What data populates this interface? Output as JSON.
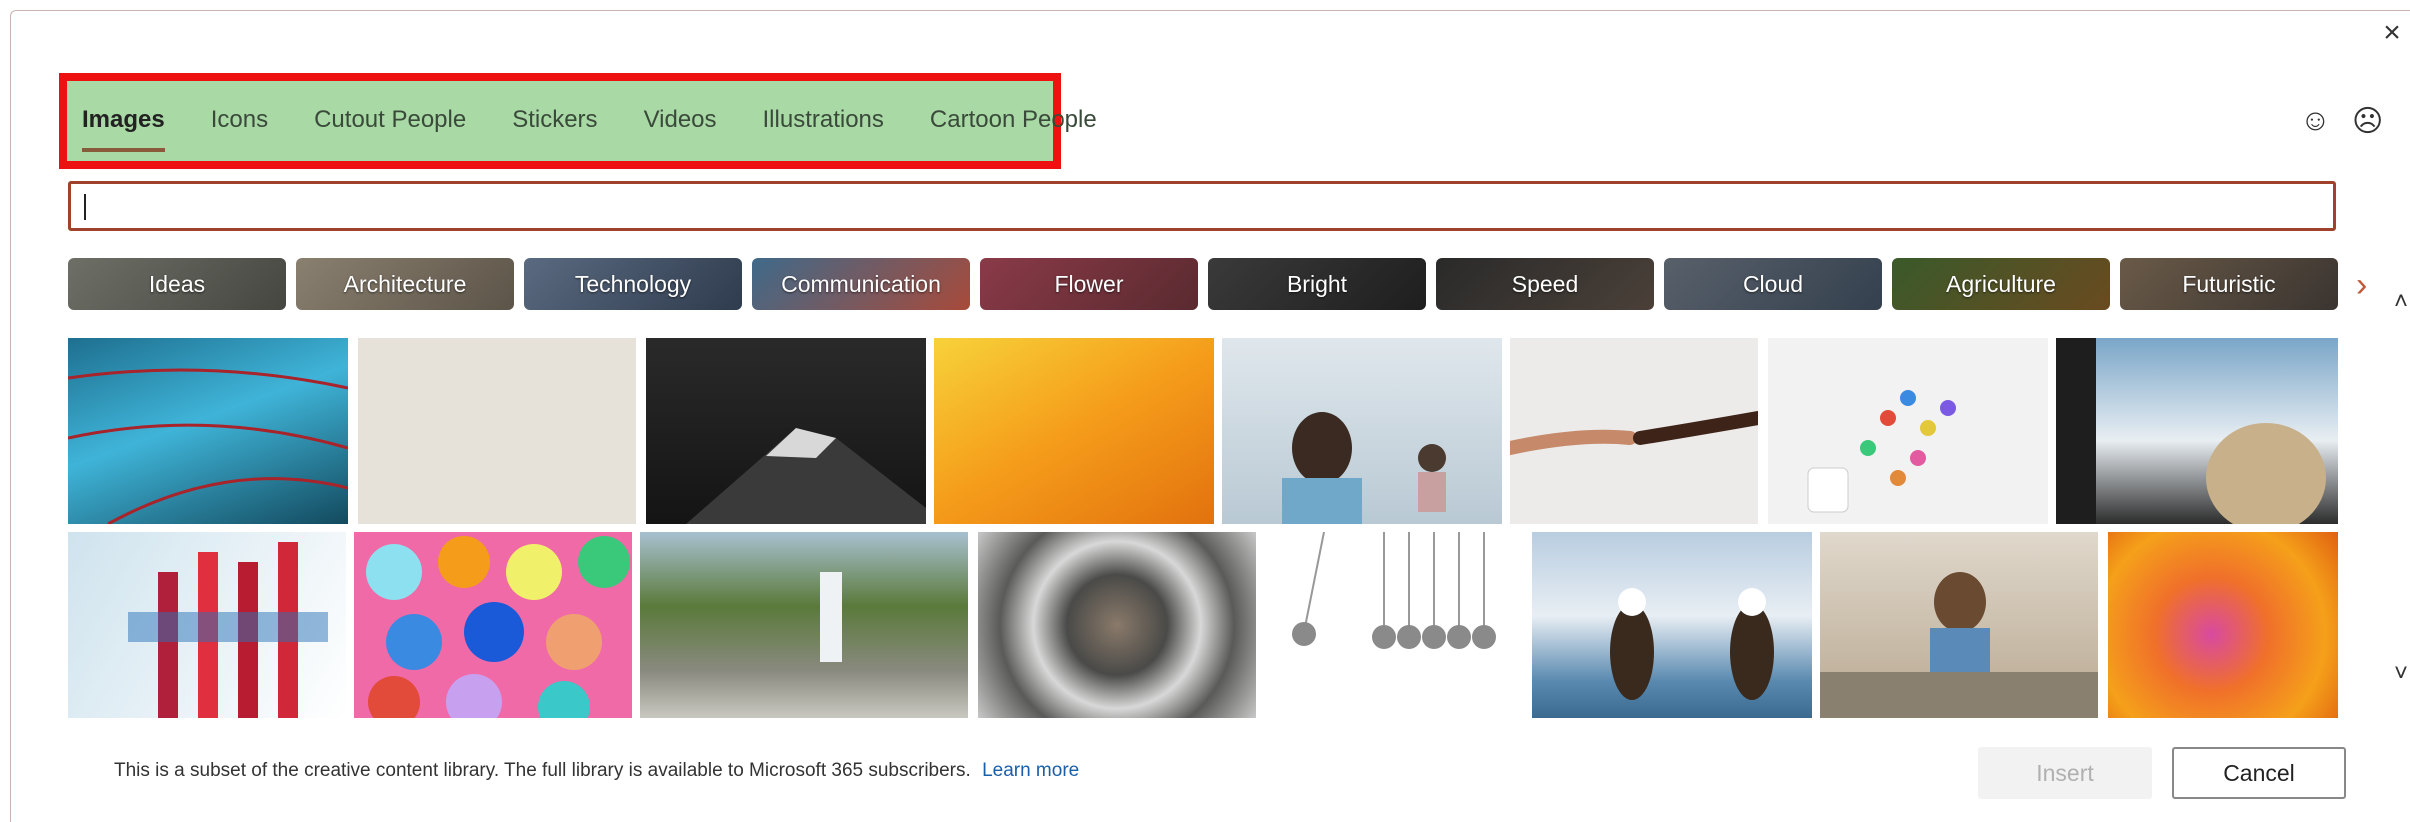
{
  "dialog": {
    "close_glyph": "×",
    "tabs": [
      {
        "label": "Images",
        "active": true
      },
      {
        "label": "Icons",
        "active": false
      },
      {
        "label": "Cutout People",
        "active": false
      },
      {
        "label": "Stickers",
        "active": false
      },
      {
        "label": "Videos",
        "active": false
      },
      {
        "label": "Illustrations",
        "active": false
      },
      {
        "label": "Cartoon People",
        "active": false
      }
    ],
    "feedback": {
      "smile_glyph": "☺",
      "frown_glyph": "☹"
    },
    "search": {
      "value": "",
      "placeholder": ""
    },
    "categories": [
      {
        "label": "Ideas"
      },
      {
        "label": "Architecture"
      },
      {
        "label": "Technology"
      },
      {
        "label": "Communication"
      },
      {
        "label": "Flower"
      },
      {
        "label": "Bright"
      },
      {
        "label": "Speed"
      },
      {
        "label": "Cloud"
      },
      {
        "label": "Agriculture"
      },
      {
        "label": "Futuristic"
      }
    ],
    "next_glyph": "›",
    "images_row1": [
      {
        "name": "image-water-droplets-wire"
      },
      {
        "name": "image-linen-texture"
      },
      {
        "name": "image-mountain-peak"
      },
      {
        "name": "image-orange-yellow-abstract"
      },
      {
        "name": "image-children-classroom"
      },
      {
        "name": "image-hands-reaching"
      },
      {
        "name": "image-colorful-pills"
      },
      {
        "name": "image-woman-car-camera"
      }
    ],
    "images_row2": [
      {
        "name": "image-test-tubes"
      },
      {
        "name": "image-colorful-buttons"
      },
      {
        "name": "image-waterfall"
      },
      {
        "name": "image-man-camera-lens"
      },
      {
        "name": "image-newtons-cradle"
      },
      {
        "name": "image-bald-eagles"
      },
      {
        "name": "image-girl-drawing"
      },
      {
        "name": "image-nautilus-shell"
      }
    ],
    "footer": {
      "text": "This is a subset of the creative content library. The full library is available to Microsoft 365 subscribers.",
      "link": "Learn more"
    },
    "buttons": {
      "insert": "Insert",
      "cancel": "Cancel"
    }
  }
}
